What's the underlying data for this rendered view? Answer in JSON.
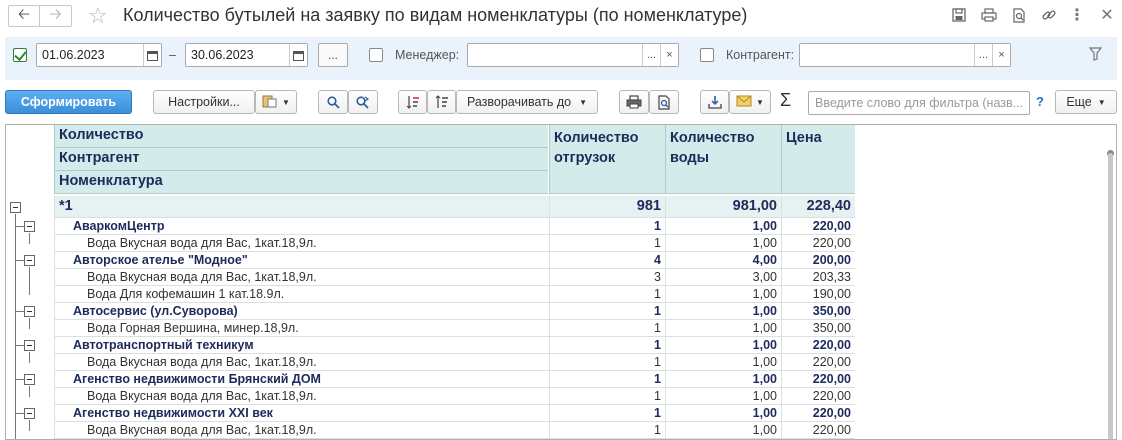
{
  "window": {
    "title": "Количество бутылей на заявку по видам номенклатуры (по номенклатуре)"
  },
  "filters": {
    "period_enabled": true,
    "date_from": "01.06.2023",
    "dash": "–",
    "date_to": "30.06.2023",
    "period_button": "...",
    "manager_label": "Менеджер:",
    "manager_value": "",
    "select_button": "...",
    "clear_button": "×",
    "counterparty_label": "Контрагент:",
    "counterparty_value": ""
  },
  "toolbar": {
    "generate": "Сформировать",
    "settings": "Настройки...",
    "expand": "Разворачивать до",
    "search_placeholder": "Введите слово для фильтра (назв...",
    "help": "?",
    "more": "Еще"
  },
  "report": {
    "row_headers": [
      "Количество",
      "Контрагент",
      "Номенклатура"
    ],
    "columns": [
      "Количество отгрузок",
      "Количество воды",
      "Цена"
    ],
    "total": {
      "name": "*1",
      "shipments": "981",
      "water": "981,00",
      "price": "228,40"
    },
    "rows": [
      {
        "type": "group",
        "name": "АваркомЦентр",
        "shipments": "1",
        "water": "1,00",
        "price": "220,00"
      },
      {
        "type": "item",
        "name": "Вода Вкусная вода для Вас, 1кат.18,9л.",
        "shipments": "1",
        "water": "1,00",
        "price": "220,00"
      },
      {
        "type": "group",
        "name": "Авторское ателье \"Модное\"",
        "shipments": "4",
        "water": "4,00",
        "price": "200,00"
      },
      {
        "type": "item",
        "name": "Вода Вкусная вода для Вас, 1кат.18,9л.",
        "shipments": "3",
        "water": "3,00",
        "price": "203,33"
      },
      {
        "type": "item",
        "name": "Вода Для кофемашин 1 кат.18.9л.",
        "shipments": "1",
        "water": "1,00",
        "price": "190,00"
      },
      {
        "type": "group",
        "name": "Автосервис (ул.Суворова)",
        "shipments": "1",
        "water": "1,00",
        "price": "350,00"
      },
      {
        "type": "item",
        "name": "Вода Горная Вершина, минер.18,9л.",
        "shipments": "1",
        "water": "1,00",
        "price": "350,00"
      },
      {
        "type": "group",
        "name": "Автотранспортный техникум",
        "shipments": "1",
        "water": "1,00",
        "price": "220,00"
      },
      {
        "type": "item",
        "name": "Вода Вкусная вода для Вас, 1кат.18,9л.",
        "shipments": "1",
        "water": "1,00",
        "price": "220,00"
      },
      {
        "type": "group",
        "name": "Агенство недвижимости  Брянский ДОМ",
        "shipments": "1",
        "water": "1,00",
        "price": "220,00"
      },
      {
        "type": "item",
        "name": "Вода Вкусная вода для Вас, 1кат.18,9л.",
        "shipments": "1",
        "water": "1,00",
        "price": "220,00"
      },
      {
        "type": "group",
        "name": "Агенство недвижимости XXI век",
        "shipments": "1",
        "water": "1,00",
        "price": "220,00"
      },
      {
        "type": "item",
        "name": "Вода Вкусная вода для Вас, 1кат.18,9л.",
        "shipments": "1",
        "water": "1,00",
        "price": "220,00"
      }
    ]
  },
  "icons": [
    "back-arrow-icon",
    "forward-arrow-icon",
    "favorite-star-icon",
    "save-icon",
    "print-icon",
    "preview-icon",
    "link-icon",
    "more-vertical-icon",
    "close-icon",
    "filter-funnel-icon",
    "calendar-icon",
    "search-icon",
    "search-next-icon",
    "sort-asc-icon",
    "sort-desc-icon",
    "export-icon",
    "mail-icon",
    "sigma-icon"
  ]
}
